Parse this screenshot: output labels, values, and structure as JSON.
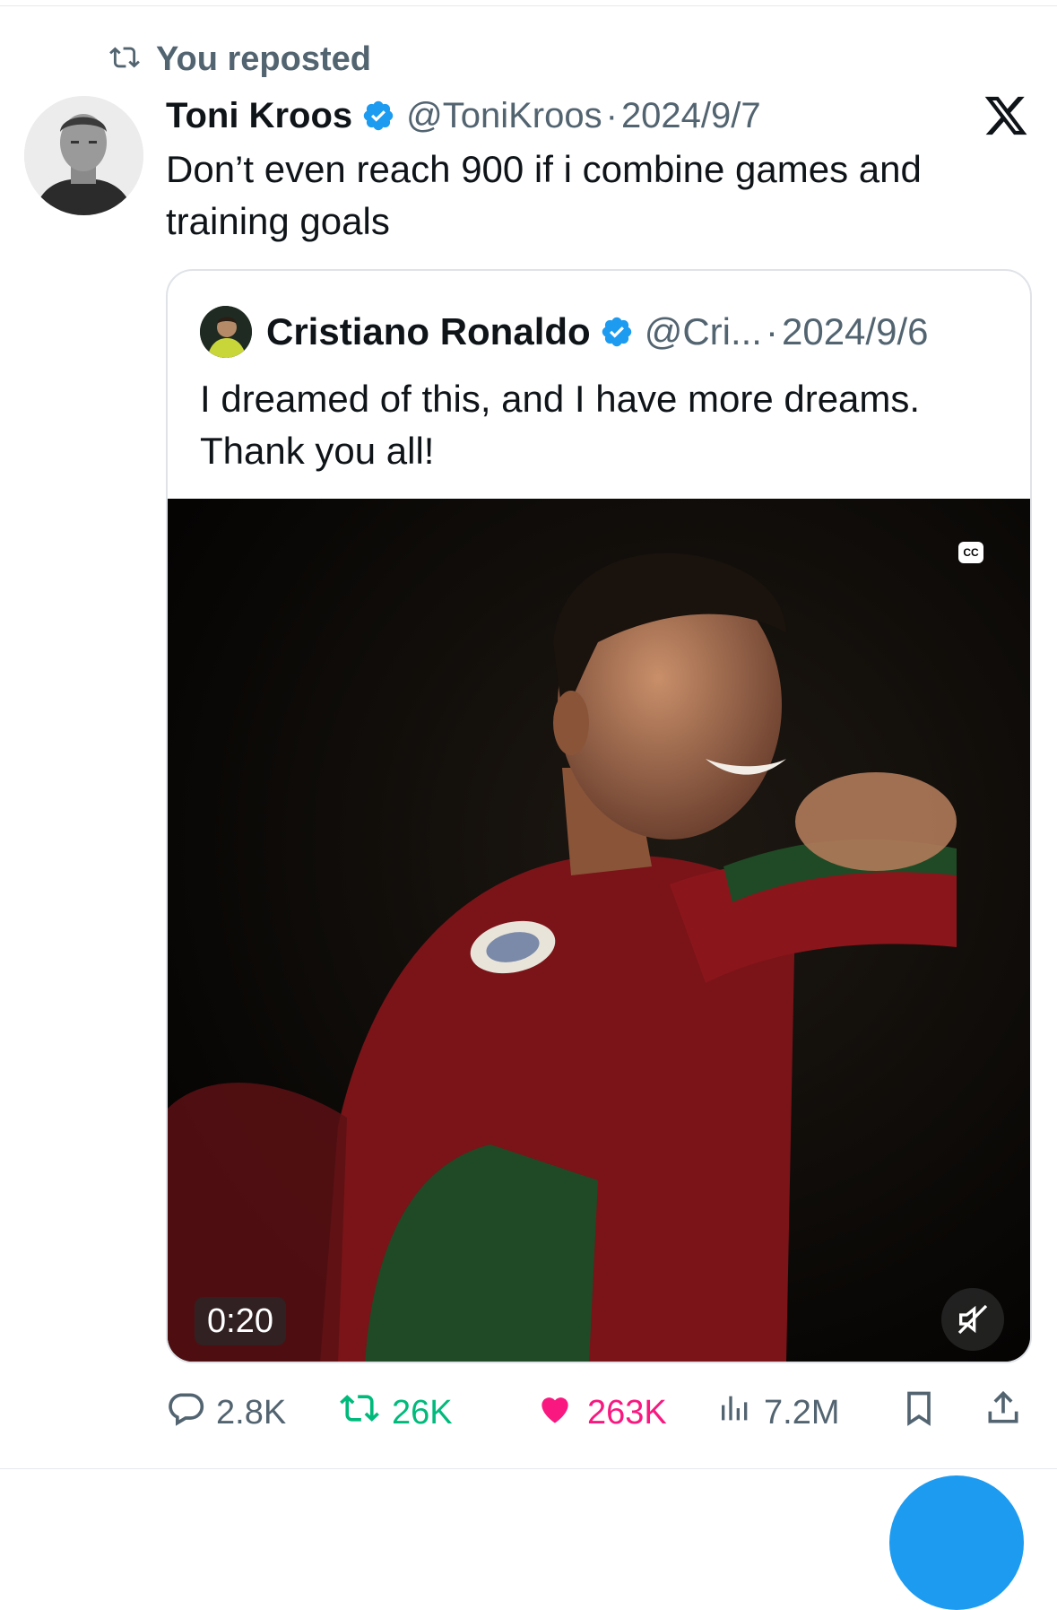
{
  "repost": {
    "label": "You reposted"
  },
  "tweet": {
    "author_name": "Toni Kroos",
    "handle": "@ToniKroos",
    "separator": "·",
    "date": "2024/9/7",
    "text": "Don’t even reach 900 if i combine games and training goals"
  },
  "quote": {
    "author_name": "Cristiano Ronaldo",
    "handle": "@Cri...",
    "separator": "·",
    "date": "2024/9/6",
    "text_line1": "I dreamed of this, and I have more dreams.",
    "text_line2": "Thank you all!",
    "video": {
      "captions_badge": "CC",
      "duration": "0:20"
    }
  },
  "actions": {
    "replies": "2.8K",
    "reposts": "26K",
    "likes": "263K",
    "views": "7.2M"
  },
  "colors": {
    "text": "#0f1419",
    "secondary": "#536471",
    "verified": "#1d9bf0",
    "repost_green": "#00ba7c",
    "like_pink": "#f91880",
    "fab_blue": "#1d9bf0"
  },
  "icons": [
    "repost-icon",
    "verified-badge-icon",
    "x-logo-icon",
    "reply-icon",
    "heart-icon",
    "views-icon",
    "bookmark-icon",
    "share-icon",
    "mute-icon",
    "captions-icon"
  ]
}
